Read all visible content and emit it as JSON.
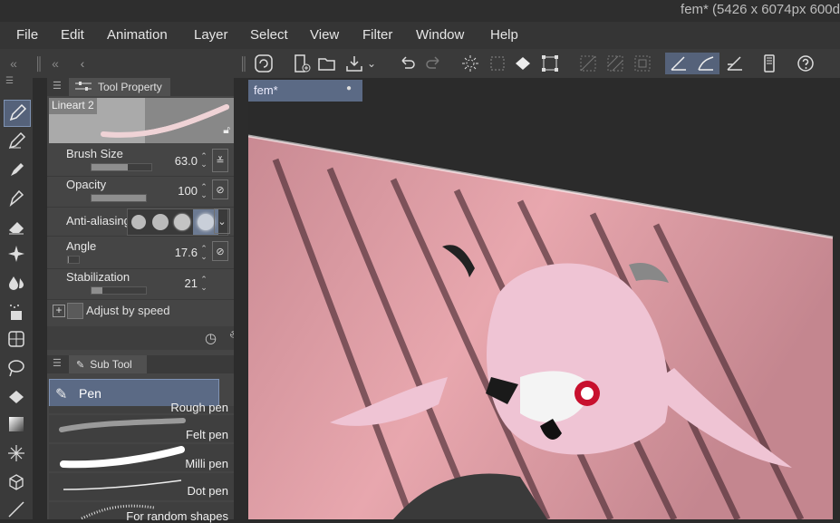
{
  "window": {
    "title": "fem* (5426 x 6074px 600d"
  },
  "menu": [
    "File",
    "Edit",
    "Animation",
    "Layer",
    "Select",
    "View",
    "Filter",
    "Window",
    "Help"
  ],
  "command_bar": {
    "icons": [
      "clip-studio-icon",
      "new-icon",
      "open-icon",
      "save-icon",
      "save-dropdown-icon",
      "undo-icon",
      "redo-icon",
      "clear-icon",
      "fill-icon",
      "transform-icon",
      "select-all-icon",
      "deselect-icon",
      "snap-ruler-icon",
      "snap-special-icon",
      "snap-grid-icon",
      "phone-icon",
      "help-icon"
    ]
  },
  "tool_property": {
    "tab_label": "Tool Property",
    "preset_name": "Lineart 2",
    "brush_size": {
      "label": "Brush Size",
      "value": "63.0",
      "fraction": 0.6
    },
    "opacity": {
      "label": "Opacity",
      "value": "100",
      "fraction": 1.0
    },
    "anti_aliasing": {
      "label": "Anti-aliasing"
    },
    "angle": {
      "label": "Angle",
      "value": "17.6",
      "fraction": 0.05
    },
    "stabilization": {
      "label": "Stabilization",
      "value": "21",
      "fraction": 0.2
    },
    "adjust_by_speed": {
      "label": "Adjust by speed"
    }
  },
  "sub_tool": {
    "tab_label": "Sub Tool",
    "group": "Pen",
    "items": [
      "Rough pen",
      "Felt pen",
      "Milli pen",
      "Dot pen",
      "For random shapes"
    ]
  },
  "canvas": {
    "tab_label": "fem*"
  },
  "colors": {
    "accent": "#5b6a85",
    "panel": "#454545",
    "bar": "#353535"
  }
}
